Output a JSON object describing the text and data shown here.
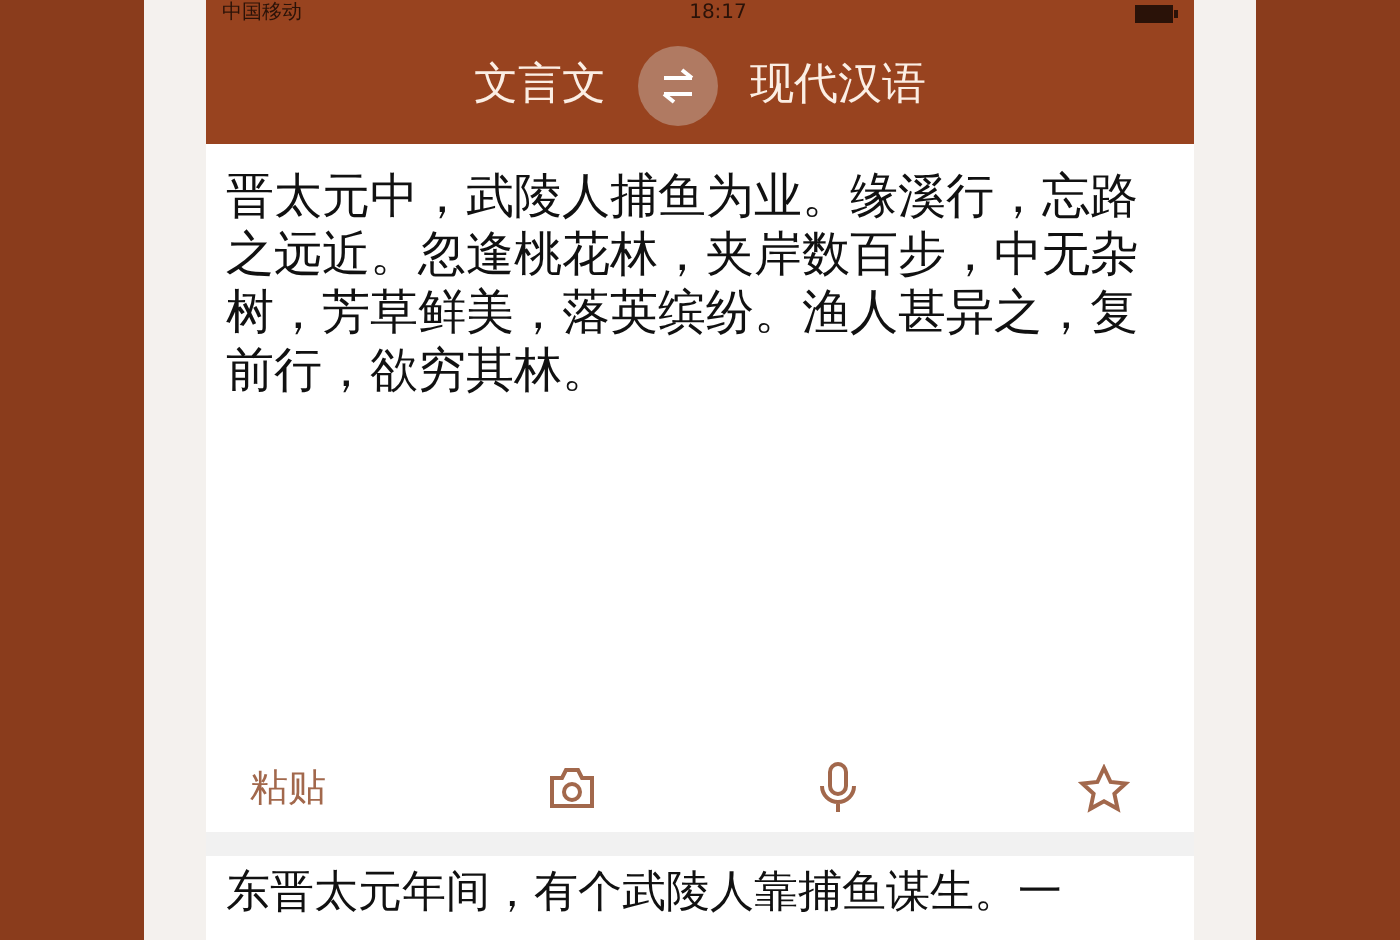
{
  "status_bar": {
    "carrier": "中国移动",
    "time": "18:17"
  },
  "header": {
    "source_language": "文言文",
    "target_language": "现代汉语"
  },
  "input": {
    "text": "晋太元中，武陵人捕鱼为业。缘溪行，忘路之远近。忽逢桃花林，夹岸数百步，中无杂树，芳草鲜美，落英缤纷。渔人甚异之，复前行，欲穷其林。"
  },
  "toolbar": {
    "paste": "粘贴"
  },
  "output": {
    "text": "东晋太元年间，有个武陵人靠捕鱼谋生。一"
  }
}
